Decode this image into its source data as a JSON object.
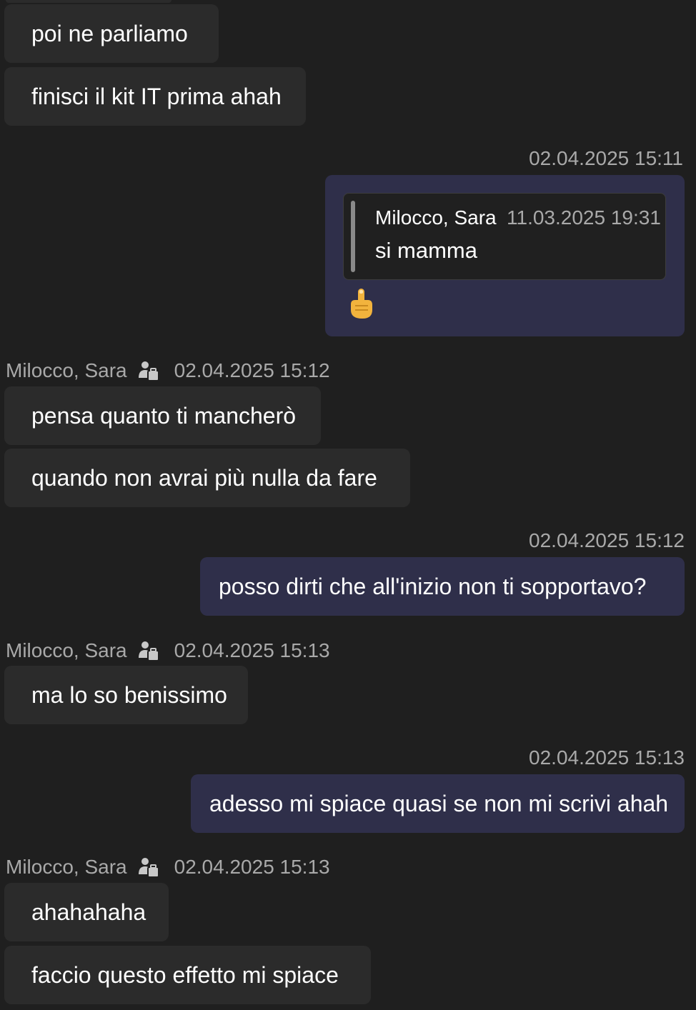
{
  "messages": {
    "m1": "poi ne parliamo",
    "m2": "finisci il kit IT prima ahah",
    "m4": "pensa quanto ti mancherò",
    "m5": "quando non avrai più nulla da fare",
    "m6": "posso dirti che all'inizio non ti sopportavo?",
    "m7": "ma lo so benissimo",
    "m8": "adesso mi spiace quasi se non mi scrivi ahah",
    "m9": "ahahahaha",
    "m10": "faccio questo effetto mi spiace"
  },
  "timestamps": {
    "t1": "02.04.2025 15:11",
    "t2": "02.04.2025 15:12",
    "t3": "02.04.2025 15:12",
    "t4": "02.04.2025 15:13",
    "t5": "02.04.2025 15:13",
    "t6": "02.04.2025 15:13"
  },
  "sender": {
    "name": "Milocco, Sara",
    "icon": "organization-icon"
  },
  "quote": {
    "author": "Milocco, Sara",
    "time": "11.03.2025 19:31",
    "text": "si mamma",
    "reply_emoji": "☝️"
  },
  "colors": {
    "background": "#1f1f1f",
    "incoming_bubble": "#2b2b2b",
    "outgoing_bubble": "#2f2f4a",
    "meta_text": "#a9a9a9",
    "quote_bar": "#8a8a8a"
  }
}
